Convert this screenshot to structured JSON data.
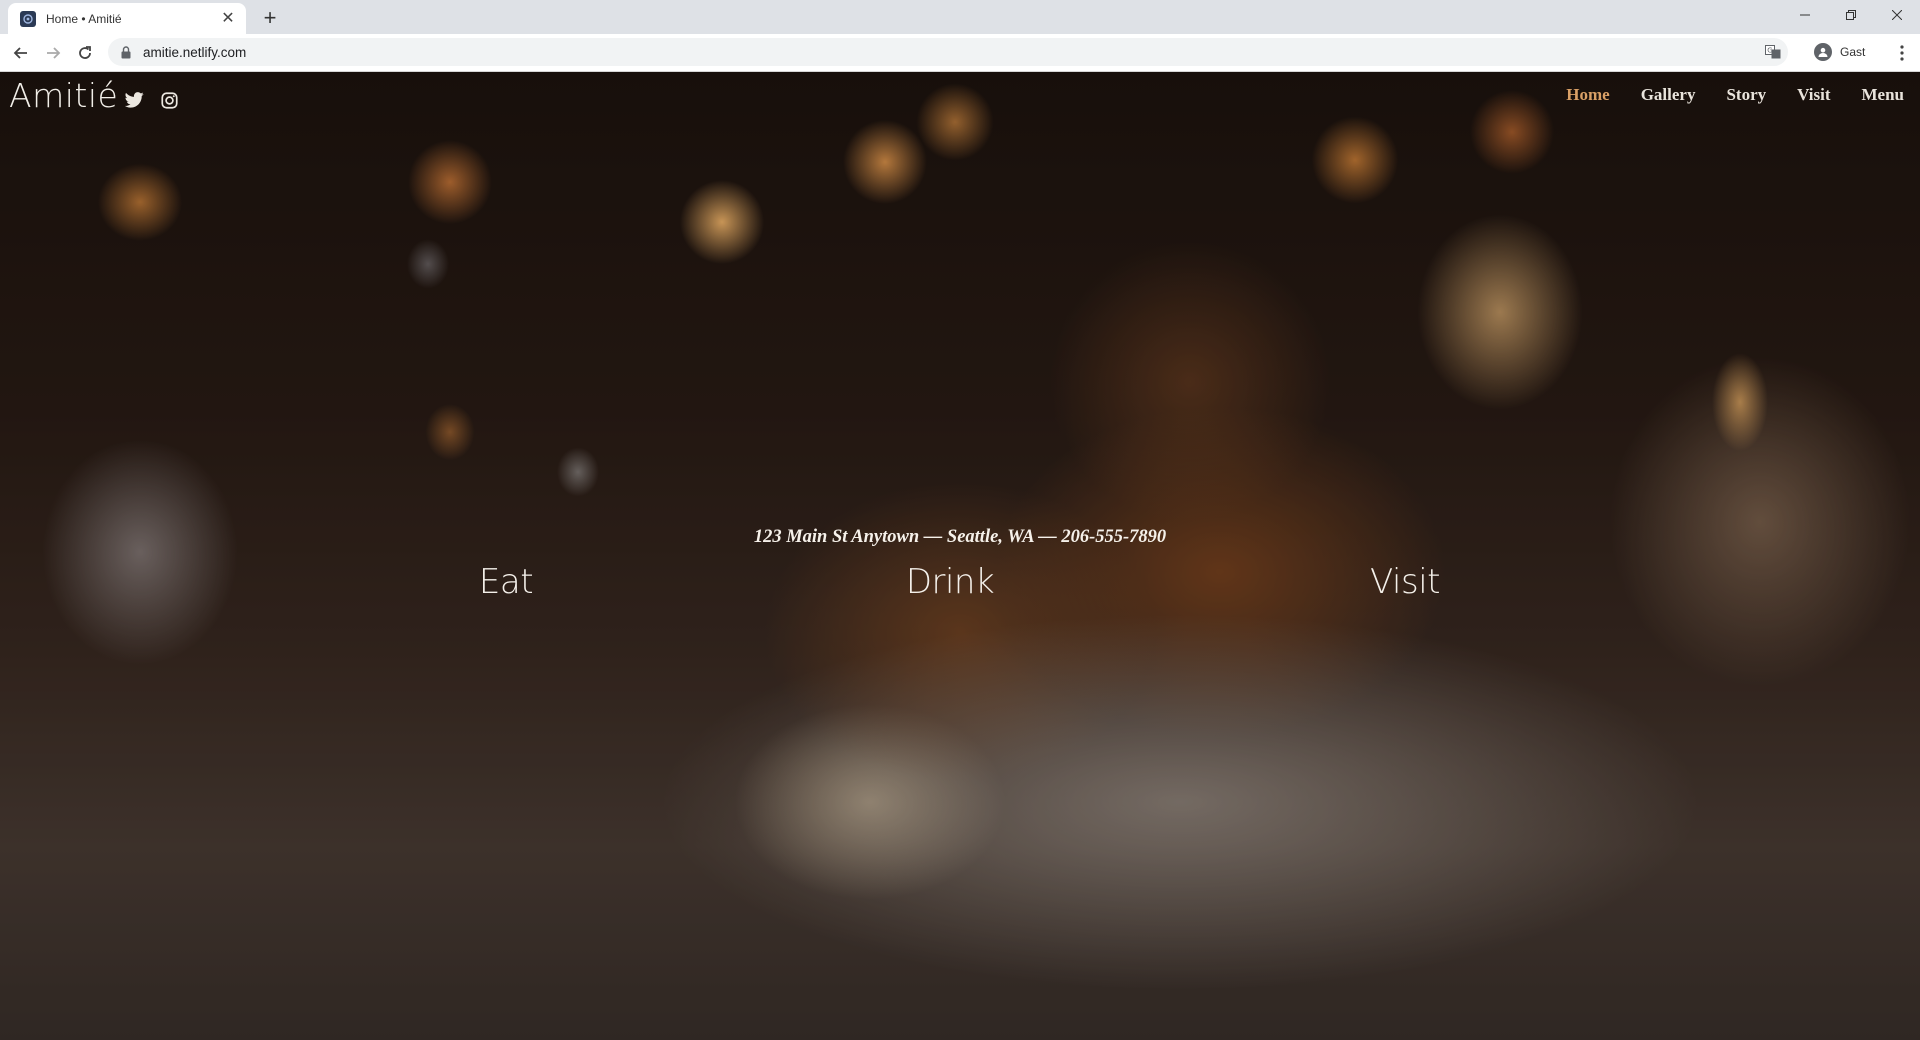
{
  "browser": {
    "tab_title": "Home • Amitié",
    "url": "amitie.netlify.com",
    "profile_label": "Gast"
  },
  "site": {
    "brand": "Amitié",
    "nav": [
      {
        "label": "Home",
        "active": true
      },
      {
        "label": "Gallery",
        "active": false
      },
      {
        "label": "Story",
        "active": false
      },
      {
        "label": "Visit",
        "active": false
      },
      {
        "label": "Menu",
        "active": false
      }
    ],
    "social_icons": [
      "twitter-icon",
      "instagram-icon"
    ],
    "address": "123 Main St Anytown — Seattle, WA — 206-555-7890",
    "pillars": [
      "Eat",
      "Drink",
      "Visit"
    ],
    "accent_color": "#d9a066"
  }
}
